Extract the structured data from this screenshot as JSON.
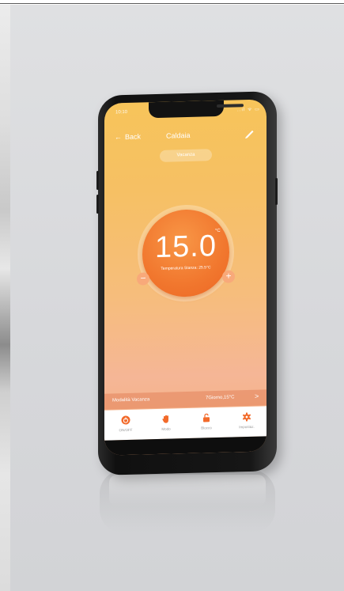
{
  "status": {
    "time": "10:10",
    "icons": "..ıl ᯤ ▭"
  },
  "appbar": {
    "back_label": "Back",
    "title": "Caldaia"
  },
  "mode_pill": "Vacanza",
  "thermostat": {
    "value": "15.0",
    "unit": "°C",
    "subtitle": "Temperatura Stanza: 25.5°C",
    "minus": "−",
    "plus": "+"
  },
  "vacation": {
    "label": "Modalità Vacanza",
    "value": "7Giorno,15°C",
    "chevron": ">"
  },
  "tabs": [
    {
      "label": "ON/OFF",
      "icon": "power-icon",
      "color": "#f26a2a"
    },
    {
      "label": "Modo",
      "icon": "hand-icon",
      "color": "#f26a2a"
    },
    {
      "label": "Blocco",
      "icon": "unlock-icon",
      "color": "#f26a2a"
    },
    {
      "label": "Impostaz.",
      "icon": "gear-icon",
      "color": "#f26a2a"
    }
  ],
  "colors": {
    "accent": "#f26a2a",
    "screen_top": "#f7c45a",
    "screen_bottom": "#f5b07e"
  }
}
